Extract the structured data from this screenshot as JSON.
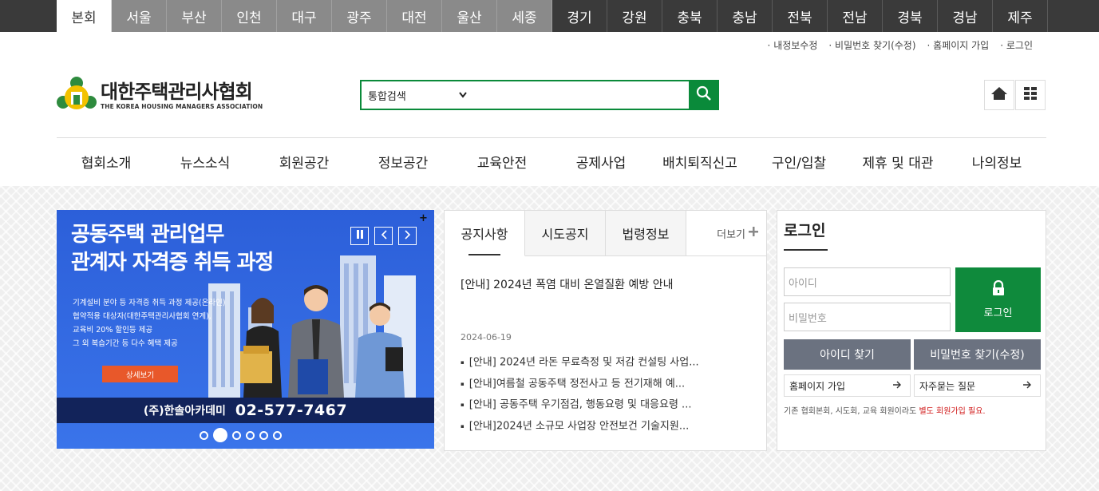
{
  "regions": [
    {
      "label": "본회",
      "kind": "active"
    },
    {
      "label": "서울",
      "kind": "city"
    },
    {
      "label": "부산",
      "kind": "city"
    },
    {
      "label": "인천",
      "kind": "city"
    },
    {
      "label": "대구",
      "kind": "city"
    },
    {
      "label": "광주",
      "kind": "city"
    },
    {
      "label": "대전",
      "kind": "city"
    },
    {
      "label": "울산",
      "kind": "city"
    },
    {
      "label": "세종",
      "kind": "city"
    },
    {
      "label": "경기",
      "kind": "province"
    },
    {
      "label": "강원",
      "kind": "province"
    },
    {
      "label": "충북",
      "kind": "province"
    },
    {
      "label": "충남",
      "kind": "province"
    },
    {
      "label": "전북",
      "kind": "province"
    },
    {
      "label": "전남",
      "kind": "province"
    },
    {
      "label": "경북",
      "kind": "province"
    },
    {
      "label": "경남",
      "kind": "province"
    },
    {
      "label": "제주",
      "kind": "province"
    }
  ],
  "util_links": [
    "내정보수정",
    "비밀번호 찾기(수정)",
    "홈페이지 가입",
    "로그인"
  ],
  "logo": {
    "title": "대한주택관리사협회",
    "subtitle": "THE KOREA HOUSING MANAGERS ASSOCIATION"
  },
  "search": {
    "select_value": "통합검색",
    "placeholder": ""
  },
  "gnb": [
    "협회소개",
    "뉴스소식",
    "회원공간",
    "정보공간",
    "교육안전",
    "공제사업",
    "배치퇴직신고",
    "구인/입찰",
    "제휴 및 대관",
    "나의정보"
  ],
  "banner": {
    "title_line1": "공동주택 관리업무",
    "title_line2": "관계자 자격증 취득 과정",
    "line1": "기계설비 분야 등 자격증 취득 과정 제공(온라인)",
    "line2": "협약적용 대상자(대한주택관리사협회 연계),",
    "line3": "교육비 20% 할인등 제공",
    "line4": "그 외 복습기간 등 다수 혜택 제공",
    "button": "상세보기",
    "company": "(주)한솔아카데미",
    "phone": "02-577-7467",
    "slide_count": 6,
    "active_slide": 2
  },
  "notice": {
    "tabs": [
      "공지사항",
      "시도공지",
      "법령정보"
    ],
    "more_label": "더보기",
    "top_title": "[안내] 2024년 폭염 대비 온열질환 예방 안내",
    "top_date": "2024-06-19",
    "items": [
      "[안내] 2024년 라돈 무료측정 및 저감 컨설팅 사업...",
      "[안내]여름철 공동주택 정전사고 등 전기재해 예...",
      "[안내] 공동주택 우기점검, 행동요령 및 대응요령 ...",
      "[안내]2024년 소규모 사업장 안전보건 기술지원..."
    ]
  },
  "login": {
    "title": "로그인",
    "id_placeholder": "아이디",
    "pw_placeholder": "비밀번호",
    "login_button": "로그인",
    "find_id": "아이디 찾기",
    "find_pw": "비밀번호 찾기(수정)",
    "signup": "홈페이지 가입",
    "faq": "자주묻는 질문",
    "note_plain": "기존 협회본회, 시도회, 교육 회원이라도 ",
    "note_red": "별도 회원가입 필요."
  },
  "colors": {
    "brand_green": "#0a8a3a",
    "banner_blue": "#2c5fd9",
    "find_gray": "#6b7280"
  }
}
